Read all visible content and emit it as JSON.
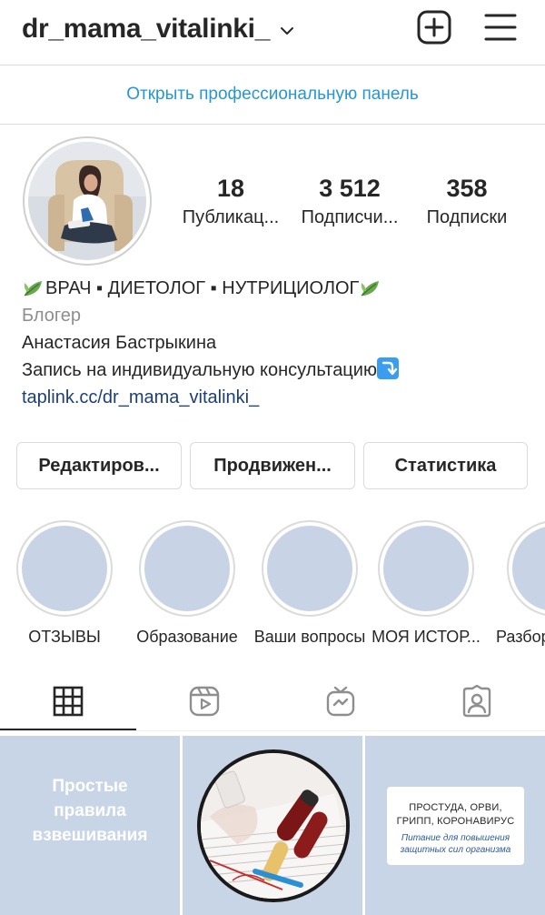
{
  "header": {
    "username": "dr_mama_vitalinki_",
    "icons": {
      "dropdown": "chevron-down-icon",
      "create": "plus-square-icon",
      "menu": "hamburger-menu-icon"
    }
  },
  "pro_panel": {
    "label": "Открыть профессиональную панель"
  },
  "profile": {
    "avatar": "profile-photo",
    "stats": {
      "posts": {
        "count": "18",
        "label": "Публикац..."
      },
      "followers": {
        "count": "3 512",
        "label": "Подписчи..."
      },
      "following": {
        "count": "358",
        "label": "Подписки"
      }
    }
  },
  "bio": {
    "title": "ВРАЧ ▪ ДИЕТОЛОГ ▪ НУТРИЦИОЛОГ",
    "category": "Блогер",
    "name": "Анастасия Бастрыкина",
    "text": "Запись на индивидуальную консультацию",
    "link": "taplink.cc/dr_mama_vitalinki_"
  },
  "buttons": {
    "edit": "Редактиров...",
    "promo": "Продвижен...",
    "stats": "Статистика"
  },
  "highlights": [
    {
      "label": "ОТЗЫВЫ"
    },
    {
      "label": "Образование"
    },
    {
      "label": "Ваши вопросы"
    },
    {
      "label": "МОЯ ИСТОР..."
    },
    {
      "label": "Разбор"
    }
  ],
  "tabs": [
    {
      "icon": "grid-icon",
      "active": true
    },
    {
      "icon": "reels-icon",
      "active": false
    },
    {
      "icon": "igtv-icon",
      "active": false
    },
    {
      "icon": "tagged-icon",
      "active": false
    }
  ],
  "posts": {
    "post1": {
      "lines": [
        "Простые",
        "правила",
        "взвешивания"
      ]
    },
    "post2": {
      "image": "lab-test-tubes-photo"
    },
    "post3": {
      "title_lines": [
        "ПРОСТУДА, ОРВИ,",
        "ГРИПП, КОРОНАВИРУС"
      ],
      "sub_lines": [
        "Питание для повышения",
        "защитных сил организма"
      ]
    }
  },
  "colors": {
    "link_blue": "#2596d7",
    "bio_link": "#1c3f7a",
    "placeholder": "#c8d4e6",
    "text": "#262626",
    "muted": "#8e8e8e"
  }
}
